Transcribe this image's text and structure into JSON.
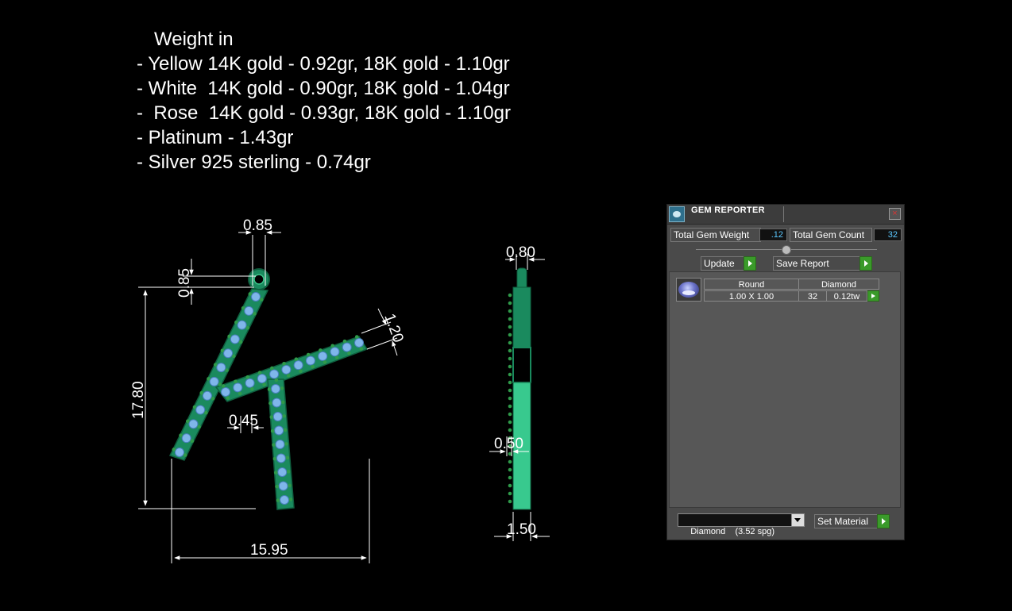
{
  "weights": {
    "header": "Weight in",
    "lines": [
      "- Yellow 14K gold - 0.92gr, 18K gold - 1.10gr",
      "- White  14K gold - 0.90gr, 18K gold - 1.04gr",
      "-  Rose  14K gold - 0.93gr, 18K gold - 1.10gr",
      "- Platinum - 1.43gr",
      "- Silver 925 sterling - 0.74gr"
    ]
  },
  "dimensions": {
    "top_width": "0.85",
    "loop_height": "0.85",
    "total_height": "17.80",
    "arm_width": "1.20",
    "gap": "0.45",
    "total_width": "15.95",
    "side_width": "0.80",
    "side_gap": "0.50",
    "side_depth": "1.50"
  },
  "gem_reporter": {
    "title": "GEM REPORTER",
    "total_weight_label": "Total Gem Weight",
    "total_weight_value": ".12",
    "total_count_label": "Total Gem Count",
    "total_count_value": "32",
    "update_label": "Update",
    "save_report_label": "Save Report",
    "row": {
      "shape": "Round",
      "material": "Diamond",
      "size": "1.00 X 1.00",
      "count": "32",
      "weight": "0.12tw"
    },
    "material_select": "Diamond    (3.52 spg)",
    "set_material_label": "Set Material"
  },
  "colors": {
    "metal": "#1a8a5e",
    "gem": "#7fb6ea",
    "prong": "#2f9a4a",
    "panel_bg": "#4a4a4a",
    "accent_green": "#3a9a2a"
  }
}
